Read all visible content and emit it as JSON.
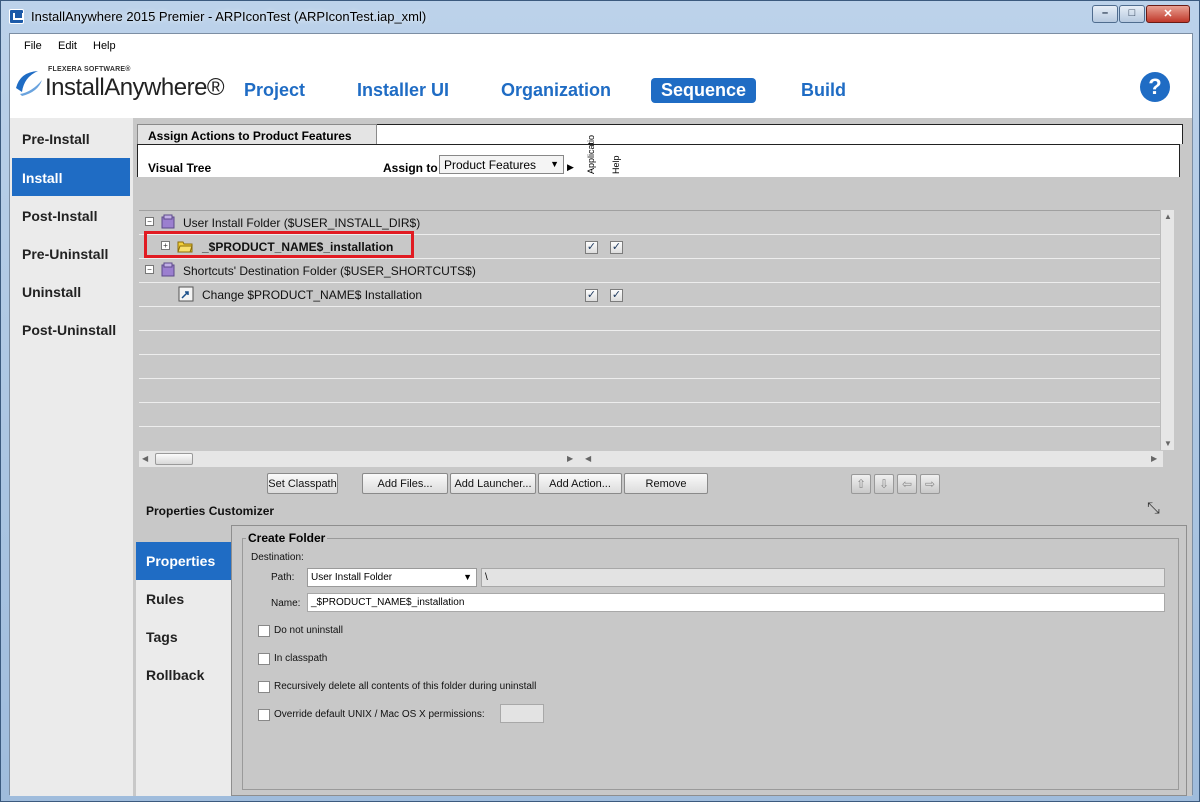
{
  "window": {
    "title": "InstallAnywhere 2015 Premier - ARPIconTest (ARPIconTest.iap_xml)",
    "minimize": "–",
    "maximize": "□",
    "close": "✕"
  },
  "menu": {
    "file": "File",
    "edit": "Edit",
    "help": "Help"
  },
  "logo": {
    "small": "FLEXERA SOFTWARE®",
    "main": "InstallAnywhere®"
  },
  "nav_tabs": {
    "project": "Project",
    "installer_ui": "Installer UI",
    "organization": "Organization",
    "sequence": "Sequence",
    "build": "Build"
  },
  "help_icon": "?",
  "left_nav": {
    "pre_install": "Pre-Install",
    "install": "Install",
    "post_install": "Post-Install",
    "pre_uninstall": "Pre-Uninstall",
    "uninstall": "Uninstall",
    "post_uninstall": "Post-Uninstall"
  },
  "assign_tab": {
    "title": "Assign Actions to Product Features",
    "visual_tree": "Visual Tree",
    "assign_to_label": "Assign to",
    "assign_to_value": "Product Features",
    "col_application": "Applicatio",
    "col_help": "Help"
  },
  "tree_rows": {
    "row0": "User Install Folder ($USER_INSTALL_DIR$)",
    "row1": "_$PRODUCT_NAME$_installation",
    "row2": "Shortcuts' Destination Folder ($USER_SHORTCUTS$)",
    "row3": "Change $PRODUCT_NAME$ Installation"
  },
  "tree_checks": {
    "checked_mark": "✓"
  },
  "buttons": {
    "set_classpath": "Set Classpath",
    "add_files": "Add Files...",
    "add_launcher": "Add Launcher...",
    "add_action": "Add Action...",
    "remove": "Remove"
  },
  "properties": {
    "title": "Properties Customizer",
    "tabs": {
      "properties": "Properties",
      "rules": "Rules",
      "tags": "Tags",
      "rollback": "Rollback"
    },
    "section": "Create Folder",
    "destination_label": "Destination:",
    "path_label": "Path:",
    "path_value": "User Install Folder",
    "path_suffix": "\\",
    "name_label": "Name:",
    "name_value": "_$PRODUCT_NAME$_installation",
    "do_not_uninstall": "Do not uninstall",
    "in_classpath": "In classpath",
    "recursive_delete": "Recursively delete all contents of this folder during uninstall",
    "override_perms": "Override default UNIX / Mac OS X permissions:",
    "override_value": ""
  },
  "colors": {
    "accent": "#1f6cc4",
    "highlight": "#e11b22"
  }
}
